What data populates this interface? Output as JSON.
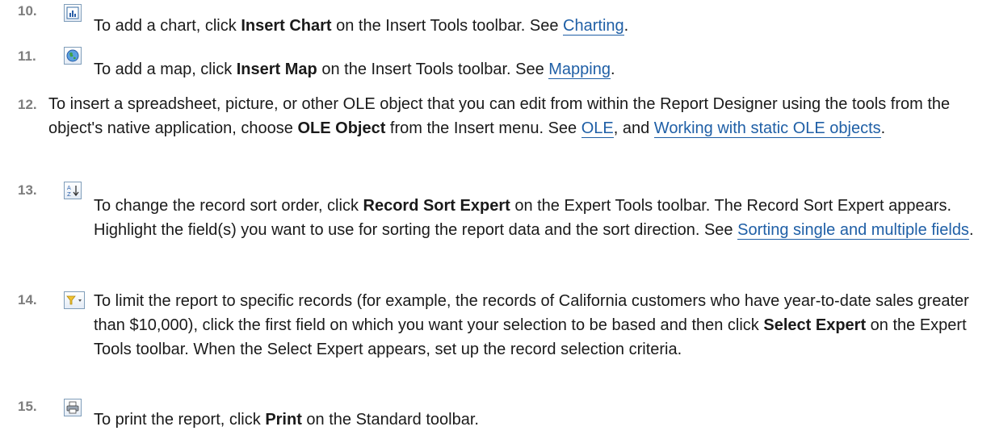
{
  "steps": [
    {
      "number": "10.",
      "icon": "insert-chart-icon",
      "pre": "To add a chart, click ",
      "bold": "Insert Chart",
      "mid": " on the Insert Tools toolbar. See ",
      "link": "Charting",
      "post": "."
    },
    {
      "number": "11.",
      "icon": "insert-map-icon",
      "pre": "To add a map, click ",
      "bold": "Insert Map",
      "mid": " on the Insert Tools toolbar. See ",
      "link": "Mapping",
      "post": "."
    },
    {
      "number": "12.",
      "pre": "To insert a spreadsheet, picture, or other OLE object that you can edit from within the Report Designer using the tools from the object's native application, choose ",
      "bold": "OLE Object",
      "mid": " from the Insert menu. See ",
      "link1": "OLE",
      "mid2": ", and ",
      "link2": "Working with static OLE objects",
      "post": "."
    },
    {
      "number": "13.",
      "icon": "sort-az-icon",
      "pre": "To change the record sort order, click ",
      "bold": "Record Sort Expert",
      "mid": " on the Expert Tools toolbar. The Record Sort Expert appears. Highlight the field(s) you want to use for sorting the report data and the sort direction. See ",
      "link": "Sorting single and multiple fields",
      "post": "."
    },
    {
      "number": "14.",
      "icon": "select-expert-filter-icon",
      "pre": "To limit the report to specific records (for example, the records of California customers who have year-to-date sales greater than $10,000), click the first field on which you want your selection to be based and then click ",
      "bold": "Select Expert",
      "post": " on the Expert Tools toolbar. When the Select Expert appears, set up the record selection criteria."
    },
    {
      "number": "15.",
      "icon": "print-icon",
      "pre": "To print the report, click ",
      "bold": "Print",
      "post": " on the Standard toolbar."
    }
  ]
}
